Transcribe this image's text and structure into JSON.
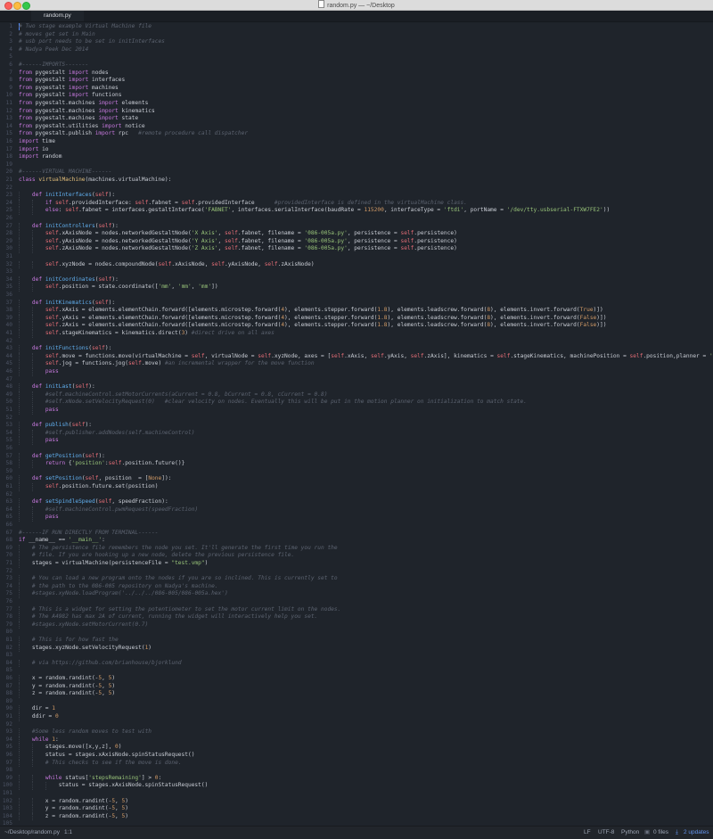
{
  "window": {
    "title": "random.py — ~/Desktop"
  },
  "tabs": [
    {
      "label": "random.py"
    }
  ],
  "status": {
    "path": "~/Desktop/random.py",
    "position": "1:1",
    "line_ending": "LF",
    "encoding": "UTF-8",
    "grammar": "Python",
    "files": "0 files",
    "updates": "2 updates"
  },
  "colors": {
    "background": "#1f242b",
    "comment": "#5c6370",
    "keyword": "#c678dd",
    "string": "#98c379",
    "function": "#61afef",
    "class": "#e5c07b",
    "number": "#d19a66",
    "self": "#e06c75",
    "text": "#c8ccd4"
  },
  "lines": [
    "# Two stage example Virtual Machine file",
    "# moves get set in Main",
    "# usb port needs to be set in initInterfaces",
    "# Nadya Peek Dec 2014",
    "",
    "#------IMPORTS-------",
    "from pygestalt import nodes",
    "from pygestalt import interfaces",
    "from pygestalt import machines",
    "from pygestalt import functions",
    "from pygestalt.machines import elements",
    "from pygestalt.machines import kinematics",
    "from pygestalt.machines import state",
    "from pygestalt.utilities import notice",
    "from pygestalt.publish import rpc   #remote procedure call dispatcher",
    "import time",
    "import io",
    "import random",
    "",
    "#------VIRTUAL MACHINE------",
    "class virtualMachine(machines.virtualMachine):",
    "",
    "    def initInterfaces(self):",
    "        if self.providedInterface: self.fabnet = self.providedInterface      #providedInterface is defined in the virtualMachine class.",
    "        else: self.fabnet = interfaces.gestaltInterface('FABNET', interfaces.serialInterface(baudRate = 115200, interfaceType = 'ftdi', portName = '/dev/tty.usbserial-FTXW7FE2'))",
    "",
    "    def initControllers(self):",
    "        self.xAxisNode = nodes.networkedGestaltNode('X Axis', self.fabnet, filename = '086-005a.py', persistence = self.persistence)",
    "        self.yAxisNode = nodes.networkedGestaltNode('Y Axis', self.fabnet, filename = '086-005a.py', persistence = self.persistence)",
    "        self.zAxisNode = nodes.networkedGestaltNode('Z Axis', self.fabnet, filename = '086-005a.py', persistence = self.persistence)",
    "",
    "        self.xyzNode = nodes.compoundNode(self.xAxisNode, self.yAxisNode, self.zAxisNode)",
    "",
    "    def initCoordinates(self):",
    "        self.position = state.coordinate(['mm', 'mm', 'mm'])",
    "",
    "    def initKinematics(self):",
    "        self.xAxis = elements.elementChain.forward([elements.microstep.forward(4), elements.stepper.forward(1.8), elements.leadscrew.forward(8), elements.invert.forward(True)])",
    "        self.yAxis = elements.elementChain.forward([elements.microstep.forward(4), elements.stepper.forward(1.8), elements.leadscrew.forward(8), elements.invert.forward(False)])",
    "        self.zAxis = elements.elementChain.forward([elements.microstep.forward(4), elements.stepper.forward(1.8), elements.leadscrew.forward(8), elements.invert.forward(False)])",
    "        self.stageKinematics = kinematics.direct(3) #direct drive on all axes",
    "",
    "    def initFunctions(self):",
    "        self.move = functions.move(virtualMachine = self, virtualNode = self.xyzNode, axes = [self.xAxis, self.yAxis, self.zAxis], kinematics = self.stageKinematics, machinePosition = self.position,planner = 'null')",
    "        self.jog = functions.jog(self.move) #an incremental wrapper for the move function",
    "        pass",
    "",
    "    def initLast(self):",
    "        #self.machineControl.setMotorCurrents(aCurrent = 0.8, bCurrent = 0.8, cCurrent = 0.8)",
    "        #self.xNode.setVelocityRequest(0)   #clear velocity on nodes. Eventually this will be put in the motion planner on initialization to match state.",
    "        pass",
    "",
    "    def publish(self):",
    "        #self.publisher.addNodes(self.machineControl)",
    "        pass",
    "",
    "    def getPosition(self):",
    "        return {'position':self.position.future()}",
    "",
    "    def setPosition(self, position  = [None]):",
    "        self.position.future.set(position)",
    "",
    "    def setSpindleSpeed(self, speedFraction):",
    "        #self.machineControl.pwmRequest(speedFraction)",
    "        pass",
    "",
    "#------IF RUN DIRECTLY FROM TERMINAL------",
    "if __name__ == '__main__':",
    "    # The persistence file remembers the node you set. It'll generate the first time you run the",
    "    # file. If you are hooking up a new node, delete the previous persistence file.",
    "    stages = virtualMachine(persistenceFile = \"test.vmp\")",
    "",
    "    # You can load a new program onto the nodes if you are so inclined. This is currently set to",
    "    # the path to the 086-005 repository on Nadya's machine.",
    "    #stages.xyNode.loadProgram('../../../086-005/086-005a.hex')",
    "",
    "    # This is a widget for setting the potentiometer to set the motor current limit on the nodes.",
    "    # The A4982 has max 2A of current, running the widget will interactively help you set.",
    "    #stages.xyNode.setMotorCurrent(0.7)",
    "",
    "    # This is for how fast the",
    "    stages.xyzNode.setVelocityRequest(1)",
    "",
    "    # via https://github.com/brianhouse/bjorklund",
    "",
    "    x = random.randint(-5, 5)",
    "    y = random.randint(-5, 5)",
    "    z = random.randint(-5, 5)",
    "",
    "    dir = 1",
    "    ddir = 0",
    "",
    "    #Some less random moves to test with",
    "    while 1:",
    "        stages.move([x,y,z], 0)",
    "        status = stages.xAxisNode.spinStatusRequest()",
    "        # This checks to see if the move is done.",
    "",
    "        while status['stepsRemaining'] > 0:",
    "            status = stages.xAxisNode.spinStatusRequest()",
    "",
    "        x = random.randint(-5, 5)",
    "        y = random.randint(-5, 5)",
    "        z = random.randint(-5, 5)",
    ""
  ]
}
